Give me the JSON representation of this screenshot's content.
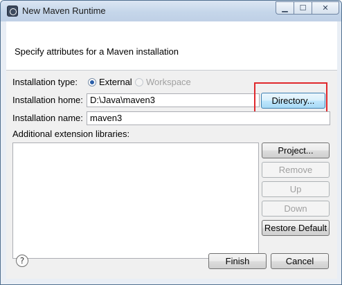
{
  "window": {
    "title": "New Maven Runtime",
    "icon": "maven-runtime-icon",
    "controls": {
      "minimize": "minimize-icon",
      "maximize": "maximize-icon",
      "close": "close-icon"
    }
  },
  "banner": {
    "message": "Specify attributes for a Maven installation"
  },
  "installation_type": {
    "label": "Installation type:",
    "options": [
      {
        "label": "External",
        "selected": true,
        "enabled": true
      },
      {
        "label": "Workspace",
        "selected": false,
        "enabled": false
      }
    ]
  },
  "installation_home": {
    "label": "Installation home:",
    "value": "D:\\Java\\maven3",
    "button": "Directory..."
  },
  "installation_name": {
    "label": "Installation name:",
    "value": "maven3"
  },
  "extensions": {
    "label": "Additional extension libraries:",
    "buttons": {
      "project": "Project...",
      "remove": "Remove",
      "up": "Up",
      "down": "Down",
      "restore_default": "Restore Default"
    }
  },
  "footer": {
    "help": "?",
    "finish": "Finish",
    "cancel": "Cancel"
  },
  "colors": {
    "highlight": "#e0272b",
    "selected_radio": "#2a5ea8"
  }
}
